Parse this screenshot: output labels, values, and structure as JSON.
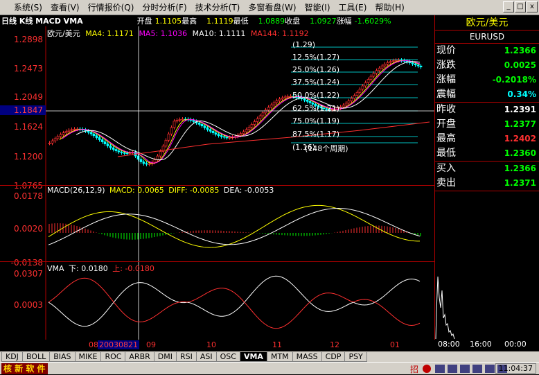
{
  "menu": [
    "系统(S)",
    "查看(V)",
    "行情报价(Q)",
    "分时分析(F)",
    "技术分析(T)",
    "多窗看盘(W)",
    "智能(I)",
    "工具(E)",
    "帮助(H)"
  ],
  "window_controls": [
    "_",
    "□",
    "x"
  ],
  "infobar": {
    "chart_tag": "日线 K线 MACD VMA",
    "open_label": "开盘",
    "open_value": "1.1105",
    "high_label": "最高",
    "high_value": "1.1119",
    "low_label": "最低",
    "low_value": "1.0889",
    "close_label": "收盘",
    "close_value": "1.0927",
    "change_label": "涨幅",
    "change_value": "-1.6029%"
  },
  "price_panel": {
    "legend": {
      "name": "欧元/美元",
      "ma4": "MA4: 1.1171",
      "ma5": "MA5: 1.1036",
      "ma10": "MA10: 1.1111",
      "ma144": "MA144: 1.1192"
    },
    "yticks": [
      "1.2898",
      "1.2473",
      "1.2049",
      "1.1624",
      "1.1200",
      "1.0765"
    ],
    "crosshair_value": "1.1847",
    "fib_levels": [
      "(1.29)",
      "12.5%(1.27)",
      "25.0%(1.26)",
      "37.5%(1.24)",
      "50.0%(1.22)",
      "62.5%(1.21)",
      "75.0%(1.19)",
      "87.5%(1.17)",
      "(1.16)"
    ],
    "fib_period_label": "(148个周期)"
  },
  "macd_panel": {
    "legend": {
      "title": "MACD(26,12,9)",
      "macd": "MACD: 0.0065",
      "diff": "DIFF: -0.0085",
      "dea": "DEA: -0.0053"
    },
    "yticks": [
      "0.0178",
      "0.0020",
      "-0.0138"
    ]
  },
  "vma_panel": {
    "legend": {
      "title": "VMA",
      "down": "下: 0.0180",
      "up": "上: -0.0180"
    },
    "yticks": [
      "0.0307",
      "0.0003"
    ]
  },
  "xaxis": {
    "labels": [
      "08",
      "20030821",
      "09",
      "10",
      "11",
      "12",
      "01"
    ]
  },
  "quote_panel": {
    "title": "欧元/美元",
    "code": "EURUSD",
    "rows_a": [
      {
        "label": "现价",
        "value": "1.2366",
        "color": "#00ff00"
      },
      {
        "label": "涨跌",
        "value": "0.0025",
        "color": "#00ff00"
      },
      {
        "label": "涨幅",
        "value": "-0.2018%",
        "color": "#00ff00"
      },
      {
        "label": "震幅",
        "value": "0.34%",
        "color": "#00ffff"
      }
    ],
    "rows_b": [
      {
        "label": "昨收",
        "value": "1.2391",
        "color": "#ffffff"
      },
      {
        "label": "开盘",
        "value": "1.2377",
        "color": "#00ff00"
      },
      {
        "label": "最高",
        "value": "1.2402",
        "color": "#ff3030"
      },
      {
        "label": "最低",
        "value": "1.2360",
        "color": "#00ff00"
      }
    ],
    "rows_c": [
      {
        "label": "买入",
        "value": "1.2366",
        "color": "#00ff00"
      },
      {
        "label": "卖出",
        "value": "1.2371",
        "color": "#00ff00"
      }
    ],
    "mini_x": [
      "08:00",
      "16:00",
      "00:00"
    ]
  },
  "tabs": [
    "KDJ",
    "BOLL",
    "BIAS",
    "MIKE",
    "ROC",
    "ARBR",
    "DMI",
    "RSI",
    "ASI",
    "OSC",
    "VMA",
    "MTM",
    "MASS",
    "CDP",
    "PSY"
  ],
  "active_tab": "VMA",
  "status": {
    "brand": "核 新 软 件",
    "badge": "招",
    "time": "11:04:37"
  },
  "colors": {
    "bg": "#000000",
    "axis": "#b00000",
    "up": "#ff3030",
    "down": "#00ffff",
    "ma4": "#ffff00",
    "ma5": "#ff00ff",
    "ma10": "#ffffff",
    "ma144": "#ff3030"
  }
}
